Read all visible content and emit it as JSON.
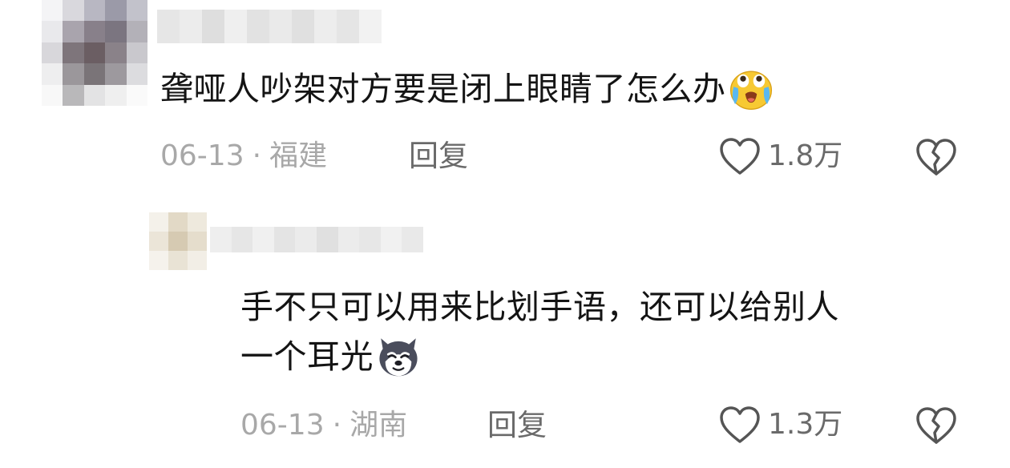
{
  "comments": [
    {
      "text": "聋哑人吵架对方要是闭上眼睛了怎么办",
      "emoji_icon": "crying-face-emoji",
      "date": "06-13",
      "separator": "·",
      "location": "福建",
      "reply_label": "回复",
      "like_count": "1.8万"
    },
    {
      "text_line1": "手不只可以用来比划手语，还可以给别人",
      "text_line2": "一个耳光",
      "emoji_icon": "husky-dog-emoji",
      "date": "06-13",
      "separator": "·",
      "location": "湖南",
      "reply_label": "回复",
      "like_count": "1.3万"
    }
  ],
  "colors": {
    "text": "#141414",
    "meta": "#a8a8a8",
    "action": "#6a6a6a",
    "icon_stroke": "#555555"
  }
}
